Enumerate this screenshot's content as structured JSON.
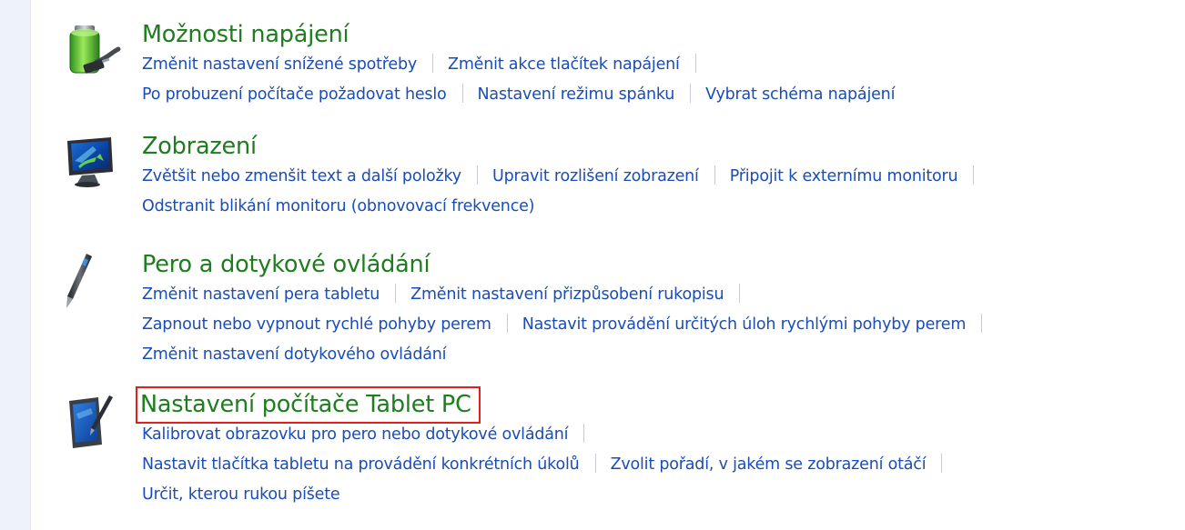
{
  "sections": [
    {
      "title": "Možnosti napájení",
      "icon": "battery-power-icon",
      "rows": [
        [
          "Změnit nastavení snížené spotřeby",
          "Změnit akce tlačítek napájení"
        ],
        [
          "Po probuzení počítače požadovat heslo",
          "Nastavení režimu spánku",
          "Vybrat schéma napájení"
        ]
      ]
    },
    {
      "title": "Zobrazení",
      "icon": "monitor-icon",
      "rows": [
        [
          "Zvětšit nebo zmenšit text a další položky",
          "Upravit rozlišení zobrazení",
          "Připojit k externímu monitoru"
        ],
        [
          "Odstranit blikání monitoru (obnovovací frekvence)"
        ]
      ]
    },
    {
      "title": "Pero a dotykové ovládání",
      "icon": "pen-icon",
      "rows": [
        [
          "Změnit nastavení pera tabletu",
          "Změnit nastavení přizpůsobení rukopisu"
        ],
        [
          "Zapnout nebo vypnout rychlé pohyby perem",
          "Nastavit provádění určitých úloh rychlými pohyby perem"
        ],
        [
          "Změnit nastavení dotykového ovládání"
        ]
      ]
    },
    {
      "title": "Nastavení počítače Tablet PC",
      "icon": "tablet-pc-icon",
      "rows": [
        [
          "Kalibrovat obrazovku pro pero nebo dotykové ovládání"
        ],
        [
          "Nastavit tlačítka tabletu na provádění konkrétních úkolů",
          "Zvolit pořadí, v jakém se zobrazení otáčí"
        ],
        [
          "Určit, kterou rukou píšete"
        ]
      ]
    }
  ],
  "colors": {
    "title": "#1e7d1e",
    "link": "#1a4db5",
    "highlight": "#e21e1e",
    "sidebar": "#eef3fa"
  }
}
